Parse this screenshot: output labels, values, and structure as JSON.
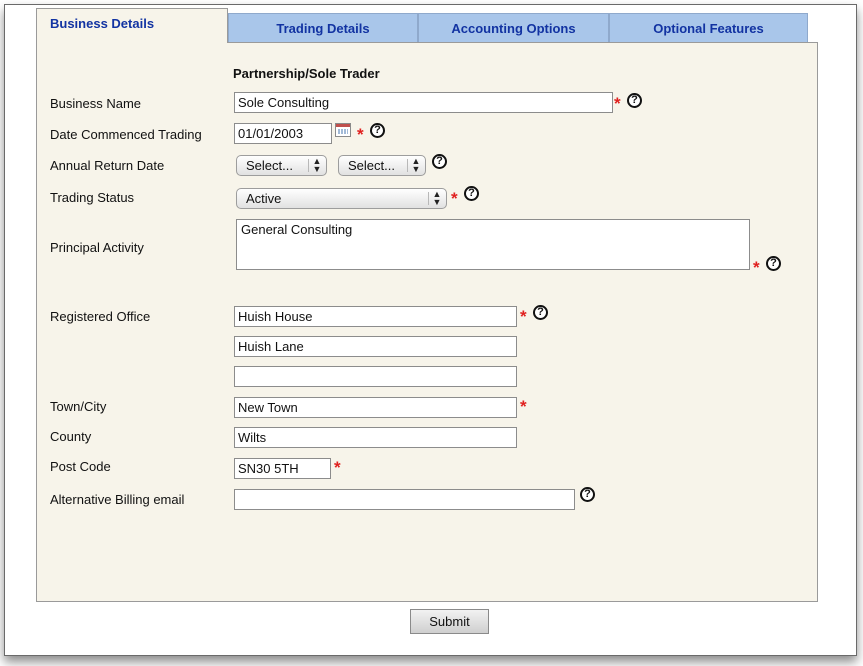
{
  "tabs": [
    {
      "label": "Business Details",
      "active": true
    },
    {
      "label": "Trading Details",
      "active": false
    },
    {
      "label": "Accounting Options",
      "active": false
    },
    {
      "label": "Optional Features",
      "active": false
    }
  ],
  "form": {
    "section_title": "Partnership/Sole Trader",
    "business_name": {
      "label": "Business Name",
      "value": "Sole Consulting"
    },
    "date_commenced": {
      "label": "Date Commenced Trading",
      "value": "01/01/2003"
    },
    "annual_return": {
      "label": "Annual Return Date",
      "select1": "Select...",
      "select2": "Select..."
    },
    "trading_status": {
      "label": "Trading Status",
      "value": "Active"
    },
    "principal_activity": {
      "label": "Principal Activity",
      "value": "General Consulting"
    },
    "registered_office": {
      "label": "Registered Office",
      "line1": "Huish House",
      "line2": "Huish Lane",
      "line3": ""
    },
    "town": {
      "label": "Town/City",
      "value": "New Town"
    },
    "county": {
      "label": "County",
      "value": "Wilts"
    },
    "postcode": {
      "label": "Post Code",
      "value": "SN30 5TH"
    },
    "billing_email": {
      "label": "Alternative Billing email",
      "value": ""
    },
    "required_marker": "*",
    "help_glyph": "?"
  },
  "submit_label": "Submit",
  "colors": {
    "tab_inactive": "#a9c6ea",
    "tab_text": "#1233a2",
    "panel_bg": "#f7f4ea",
    "required": "#e0201f"
  }
}
